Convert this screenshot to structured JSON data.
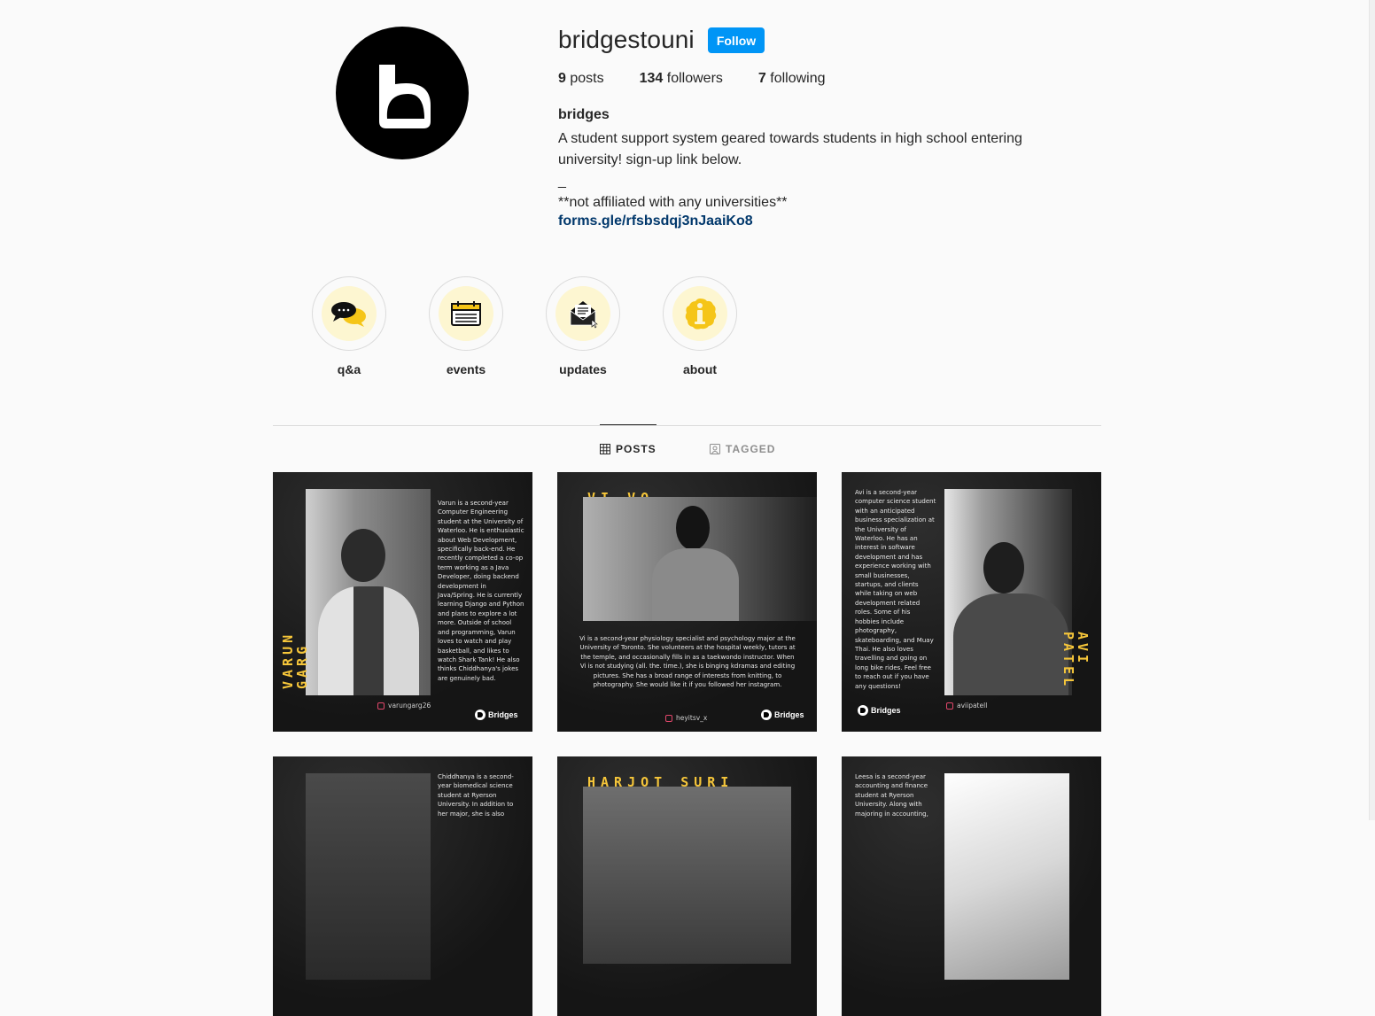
{
  "profile": {
    "username": "bridgestouni",
    "follow_label": "Follow",
    "stats": [
      {
        "count": "9",
        "label": "posts"
      },
      {
        "count": "134",
        "label": "followers"
      },
      {
        "count": "7",
        "label": "following"
      }
    ],
    "full_name": "bridges",
    "bio": "A student support system geared towards students in high school entering university! sign-up link below.\n_\n**not affiliated with any universities**",
    "link": "forms.gle/rfsbsdqj3nJaaiKo8"
  },
  "highlights": [
    {
      "label": "q&a",
      "icon": "chat-bubbles-icon"
    },
    {
      "label": "events",
      "icon": "calendar-icon"
    },
    {
      "label": "updates",
      "icon": "envelope-icon"
    },
    {
      "label": "about",
      "icon": "info-icon"
    }
  ],
  "tabs": {
    "posts": "POSTS",
    "tagged": "TAGGED"
  },
  "posts": [
    {
      "name": "VARUN GARG",
      "text": "Varun is a second-year Computer Engineering student at the University of Waterloo. He is enthusiastic about Web Development, specifically back-end. He recently completed a co-op term working as a Java Developer, doing backend development in Java/Spring. He is currently learning Django and Python and plans to explore a lot more. Outside of school and programming, Varun loves to watch and play basketball, and likes to watch Shark Tank! He also thinks Chiddhanya's jokes are genuinely bad.",
      "handle": "varungarg26",
      "brand": "Bridges"
    },
    {
      "name": "VI VO",
      "text": "Vi is a second-year physiology specialist and psychology major at the University of Toronto. She volunteers at the hospital weekly, tutors at the temple, and occasionally fills in as a taekwondo instructor. When Vi is not studying (all. the. time.), she is binging kdramas and editing pictures. She has a broad range of interests from knitting, to photography. She would like it if you followed her instagram.",
      "handle": "heyitsv_x",
      "brand": "Bridges"
    },
    {
      "name": "AVI PATEL",
      "text": "Avi is a second-year computer science student with an anticipated business specialization at the University of Waterloo. He has an interest in software development and has experience working with small businesses, startups, and clients while taking on web development related roles. Some of his hobbies include photography, skateboarding, and Muay Thai. He also loves travelling and going on long bike rides. Feel free to reach out if you have any questions!",
      "handle": "aviipatell",
      "brand": "Bridges"
    },
    {
      "name": "",
      "text": "Chiddhanya is a second-year biomedical science student at Ryerson University. In addition to her major, she is also",
      "handle": "",
      "brand": ""
    },
    {
      "name": "HARJOT SURI",
      "text": "",
      "handle": "",
      "brand": ""
    },
    {
      "name": "",
      "text": "Leesa is a second-year accounting and finance student at Ryerson University. Along with majoring in accounting,",
      "handle": "",
      "brand": ""
    }
  ]
}
